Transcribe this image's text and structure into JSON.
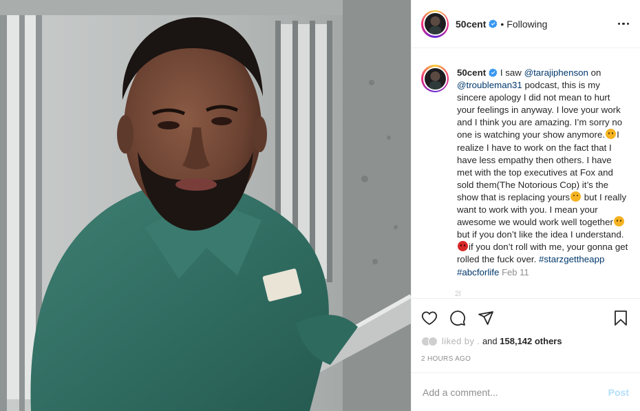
{
  "colors": {
    "accent": "#0095f6",
    "link": "#00376b",
    "muted": "#8e8e8e",
    "post_disabled": "#b2dffc",
    "verified": "#3897f0"
  },
  "post": {
    "image_alt": "photo of man in green uniform"
  },
  "header": {
    "username": "50cent",
    "separator": "•",
    "follow_status": "Following",
    "more_icon": "more-horizontal-icon"
  },
  "caption": {
    "username": "50cent",
    "segments": [
      {
        "text": " I saw ",
        "type": "text"
      },
      {
        "text": "@tarajiphenson",
        "type": "link"
      },
      {
        "text": " on ",
        "type": "text"
      },
      {
        "text": "@troubleman31",
        "type": "link"
      },
      {
        "text": " podcast, this is my sincere apology I did not mean to hurt your feelings in anyway. I love your work and I think you are amazing. I’m sorry no one is watching your show anymore.",
        "type": "text"
      },
      {
        "text": "",
        "type": "emoji-sad"
      },
      {
        "text": "I realize I have to work on the fact that I have less empathy then others. I have met with the top executives at Fox and sold them(The Notorious Cop) it’s the show that is replacing yours",
        "type": "text"
      },
      {
        "text": "",
        "type": "emoji-sad"
      },
      {
        "text": " but I really want to work with you. I mean your awesome we would work well together",
        "type": "text"
      },
      {
        "text": "",
        "type": "emoji-sad"
      },
      {
        "text": "but if you don’t like the idea I understand. ",
        "type": "text"
      },
      {
        "text": "",
        "type": "emoji-angry"
      },
      {
        "text": "if you don’t roll with me, your gonna get rolled the fuck over. ",
        "type": "text"
      },
      {
        "text": "#starzgettheapp",
        "type": "link"
      },
      {
        "text": " ",
        "type": "text"
      },
      {
        "text": "#abcforlife",
        "type": "link"
      }
    ],
    "time": "Feb 11",
    "faded_text": "2l"
  },
  "actions": {
    "like_icon": "heart-icon",
    "comment_icon": "comment-icon",
    "share_icon": "share-icon",
    "save_icon": "bookmark-icon"
  },
  "likes": {
    "liked_by": "liked by .",
    "and_text": "and",
    "count": "158,142 others"
  },
  "timestamp": "2 HOURS AGO",
  "comment": {
    "placeholder": "Add a comment...",
    "post_label": "Post"
  }
}
